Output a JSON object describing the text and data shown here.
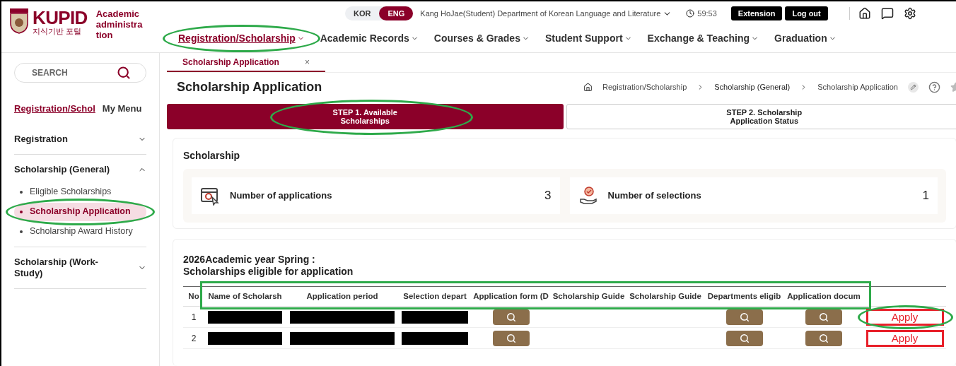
{
  "header": {
    "logo": {
      "name": "KUPID",
      "korean": "지식기반 포털",
      "subtitle": "Academic administration"
    },
    "languages": [
      {
        "label": "KOR",
        "selected": false
      },
      {
        "label": "ENG",
        "selected": true
      }
    ],
    "user": "Kang HoJae(Student) Department of Korean Language and Literature",
    "timer": "59:53",
    "buttons": [
      "Extension",
      "Log out"
    ],
    "nav": [
      {
        "label": "Registration/Scholarship",
        "selected": true
      },
      {
        "label": "Academic Records",
        "selected": false
      },
      {
        "label": "Courses & Grades",
        "selected": false
      },
      {
        "label": "Student Support",
        "selected": false
      },
      {
        "label": "Exchange & Teaching",
        "selected": false
      },
      {
        "label": "Graduation",
        "selected": false
      }
    ]
  },
  "sidebar": {
    "search": {
      "placeholder": "SEARCH"
    },
    "tabs": [
      {
        "label": "Registration/Schol",
        "selected": true
      },
      {
        "label": "My Menu",
        "selected": false
      }
    ],
    "groups": [
      {
        "label": "Registration",
        "expanded": false
      },
      {
        "label": "Scholarship (General)",
        "expanded": true,
        "children": [
          {
            "label": "Eligible Scholarships",
            "selected": false
          },
          {
            "label": "Scholarship Application",
            "selected": true
          },
          {
            "label": "Scholarship Award History",
            "selected": false
          }
        ]
      },
      {
        "label": "Scholarship (Work-Study)",
        "expanded": false
      }
    ]
  },
  "tabs": [
    {
      "label": "Scholarship Application",
      "selected": true,
      "close": "×"
    }
  ],
  "page": {
    "title": "Scholarship Application",
    "breadcrumb": [
      "Registration/Scholarship",
      "Scholarship (General)",
      "Scholarship Application"
    ],
    "steps": [
      {
        "label": "STEP 1. Available Scholarships",
        "selected": true
      },
      {
        "label": "STEP 2. Scholarship Application Status",
        "selected": false
      }
    ]
  },
  "summary": {
    "title": "Scholarship",
    "stats": [
      {
        "kind": "applications",
        "label": "Number of applications",
        "value": "3"
      },
      {
        "kind": "selections",
        "label": "Number of selections",
        "value": "1"
      }
    ]
  },
  "table": {
    "title": "2026Academic year Spring :\nScholarships eligible for application",
    "columns": [
      "No",
      "Name of Scholarsh",
      "Application period",
      "Selection depart",
      "Application form (D",
      "Scholarship Guide",
      "Scholarship Guide",
      "Departments eligib",
      "Application docum"
    ],
    "rows": [
      {
        "no": "1",
        "cells": [
          {
            "kind": "redacted"
          },
          {
            "kind": "redacted"
          },
          {
            "kind": "redacted"
          },
          {
            "kind": "view"
          },
          {
            "kind": "empty"
          },
          {
            "kind": "empty"
          },
          {
            "kind": "view"
          },
          {
            "kind": "view"
          },
          {
            "kind": "apply",
            "label": "Apply"
          }
        ]
      },
      {
        "no": "2",
        "cells": [
          {
            "kind": "redacted"
          },
          {
            "kind": "redacted"
          },
          {
            "kind": "redacted"
          },
          {
            "kind": "view"
          },
          {
            "kind": "empty"
          },
          {
            "kind": "empty"
          },
          {
            "kind": "view"
          },
          {
            "kind": "view"
          },
          {
            "kind": "apply",
            "label": "Apply"
          }
        ]
      }
    ]
  }
}
